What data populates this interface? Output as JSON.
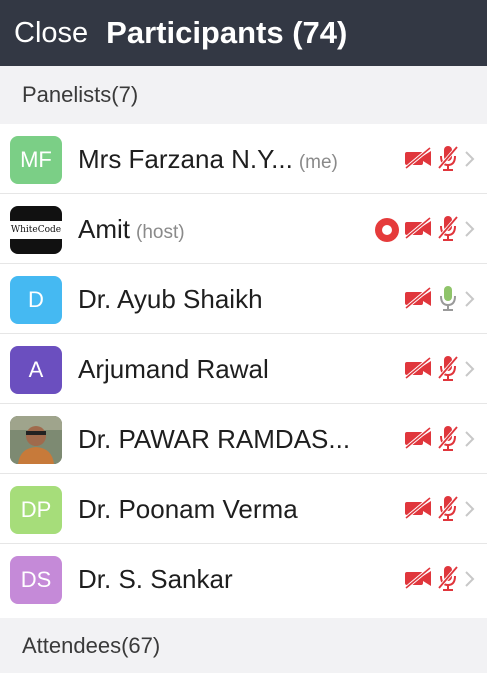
{
  "header": {
    "close_label": "Close",
    "title": "Participants (74)"
  },
  "panelists_header": "Panelists(7)",
  "attendees_header": "Attendees(67)",
  "panelists": [
    {
      "initials": "MF",
      "avatar_color": "#7bcf86",
      "name": "Mrs Farzana  N.Y...",
      "tag": "(me)",
      "video_icon": "video-off-icon",
      "mic_icon": "mic-muted-icon"
    },
    {
      "initials": "",
      "avatar_color": "#111111",
      "name": "Amit",
      "tag": "(host)",
      "video_icon": "video-off-icon",
      "mic_icon": "mic-muted-icon",
      "recording": true,
      "logo_text": "WhiteCode"
    },
    {
      "initials": "D",
      "avatar_color": "#45b9f2",
      "name": "Dr. Ayub Shaikh",
      "tag": "",
      "video_icon": "video-off-icon",
      "mic_icon": "mic-on-icon"
    },
    {
      "initials": "A",
      "avatar_color": "#6b4fbf",
      "name": "Arjumand Rawal",
      "tag": "",
      "video_icon": "video-off-icon",
      "mic_icon": "mic-muted-icon"
    },
    {
      "initials": "",
      "avatar_color": "#6a7560",
      "name": "Dr. PAWAR RAMDAS...",
      "tag": "",
      "video_icon": "video-off-icon",
      "mic_icon": "mic-muted-icon",
      "photo": true
    },
    {
      "initials": "DP",
      "avatar_color": "#a6dd7a",
      "name": "Dr. Poonam Verma",
      "tag": "",
      "video_icon": "video-off-icon",
      "mic_icon": "mic-muted-icon"
    },
    {
      "initials": "DS",
      "avatar_color": "#c58ad8",
      "name": "Dr. S. Sankar",
      "tag": "",
      "video_icon": "video-off-icon",
      "mic_icon": "mic-muted-icon"
    }
  ],
  "colors": {
    "header_bg": "#333844",
    "muted_red": "#e0363c",
    "mic_green": "#8fc46a",
    "chevron": "#c8c8c8"
  }
}
